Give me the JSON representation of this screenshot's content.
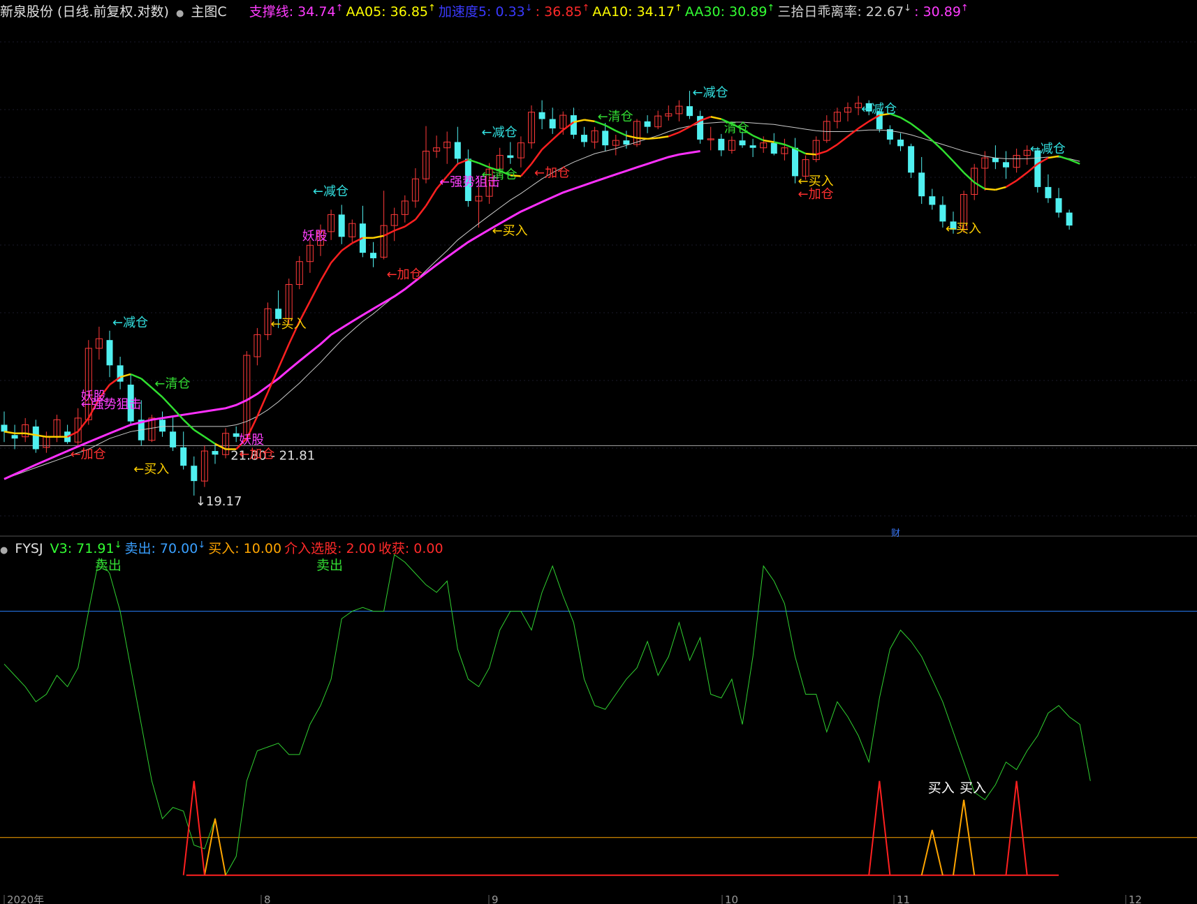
{
  "header": {
    "title": "新泉股份 (日线.前复权.对数)",
    "main_label": "主图C",
    "indicators": [
      {
        "label": "支撑线: 34.74",
        "arrow": "↑",
        "color": "#ff3cff"
      },
      {
        "label": "AA05: 36.85",
        "arrow": "↑",
        "color": "#ffff00"
      },
      {
        "label": "加速度5: 0.33",
        "arrow": "↓",
        "color": "#3a3aff"
      },
      {
        "label": ": 36.85",
        "arrow": "↑",
        "color": "#ff2a2a"
      },
      {
        "label": "AA10: 34.17",
        "arrow": "↑",
        "color": "#ffff00"
      },
      {
        "label": "AA30: 30.89",
        "arrow": "↑",
        "color": "#33ff33"
      },
      {
        "label": "三拾日乖离率: 22.67",
        "arrow": "↓",
        "color": "#d0d0d0"
      },
      {
        "label": ": 30.89",
        "arrow": "↑",
        "color": "#ff3cff"
      }
    ]
  },
  "sub_header": {
    "name": "FYSJ",
    "items": [
      {
        "label": "V3: 71.91",
        "arrow": "↓",
        "color": "#33ff33"
      },
      {
        "label": "卖出: 70.00",
        "arrow": "↓",
        "color": "#3aa0ff"
      },
      {
        "label": "买入: 10.00",
        "arrow": "",
        "color": "#ffa500"
      },
      {
        "label": "介入选股: 2.00",
        "arrow": "",
        "color": "#ff2a2a"
      },
      {
        "label": "收获: 0.00",
        "arrow": "",
        "color": "#ff2a2a"
      }
    ]
  },
  "price_labels": {
    "low": "19.17",
    "range": "21.80 - 21.81"
  },
  "signals": [
    {
      "text": "←减仓",
      "color": "#33e0e0",
      "i": 10,
      "p": 29.6
    },
    {
      "text": "←清仓",
      "color": "#33dd33",
      "i": 14,
      "p": 25.3
    },
    {
      "text": "←加仓",
      "color": "#ff3030",
      "i": 6,
      "p": 21.1
    },
    {
      "text": "←买入",
      "color": "#ffd000",
      "i": 12,
      "p": 20.3
    },
    {
      "text": "←强势狙击",
      "color": "#ff40ff",
      "i": 7,
      "p": 24.0
    },
    {
      "text": "妖股",
      "color": "#ff40ff",
      "i": 7,
      "p": 24.5
    },
    {
      "text": "妖股",
      "color": "#ff40ff",
      "i": 22,
      "p": 21.9
    },
    {
      "text": "←加仓",
      "color": "#ff3030",
      "i": 22,
      "p": 21.1
    },
    {
      "text": "←买入",
      "color": "#ffd000",
      "i": 25,
      "p": 29.5
    },
    {
      "text": "←减仓",
      "color": "#33e0e0",
      "i": 29,
      "p": 41.5
    },
    {
      "text": "妖股",
      "color": "#ff40ff",
      "i": 28,
      "p": 37.0
    },
    {
      "text": "←加仓",
      "color": "#ff3030",
      "i": 36,
      "p": 33.5
    },
    {
      "text": "←强势狙击",
      "color": "#ff40ff",
      "i": 41,
      "p": 42.5
    },
    {
      "text": "←减仓",
      "color": "#33e0e0",
      "i": 45,
      "p": 48.3
    },
    {
      "text": "←清仓",
      "color": "#33dd33",
      "i": 45,
      "p": 43.3
    },
    {
      "text": "←加仓",
      "color": "#ff3030",
      "i": 50,
      "p": 43.5
    },
    {
      "text": "←买入",
      "color": "#ffd000",
      "i": 46,
      "p": 37.5
    },
    {
      "text": "←清仓",
      "color": "#33dd33",
      "i": 56,
      "p": 50.3
    },
    {
      "text": "←减仓",
      "color": "#33e0e0",
      "i": 65,
      "p": 53.5
    },
    {
      "text": "清仓",
      "color": "#33dd33",
      "i": 68,
      "p": 48.8
    },
    {
      "text": "←买入",
      "color": "#ffd000",
      "i": 75,
      "p": 42.6
    },
    {
      "text": "←加仓",
      "color": "#ff3030",
      "i": 75,
      "p": 41.2
    },
    {
      "text": "←减仓",
      "color": "#33e0e0",
      "i": 81,
      "p": 51.3
    },
    {
      "text": "←买入",
      "color": "#ffd000",
      "i": 89,
      "p": 37.7
    },
    {
      "text": "←减仓",
      "color": "#33e0e0",
      "i": 97,
      "p": 46.3
    }
  ],
  "x_axis_labels": [
    "2020年",
    "8",
    "9",
    "10",
    "11",
    "12"
  ],
  "finance_marker": "财",
  "sub_annotations": [
    {
      "text": "卖出",
      "color": "#33dd33",
      "i": 9,
      "v": 81
    },
    {
      "text": "卖出",
      "color": "#33dd33",
      "i": 30,
      "v": 81
    },
    {
      "text": "买入",
      "color": "#ffffff",
      "i": 88,
      "v": 22
    },
    {
      "text": "买入",
      "color": "#ffffff",
      "i": 91,
      "v": 22
    }
  ],
  "chart_data": {
    "type": "candlestick",
    "scale": "log",
    "candles": [
      [
        23.0,
        23.8,
        22.0,
        22.6
      ],
      [
        22.4,
        23.0,
        21.6,
        22.2
      ],
      [
        22.3,
        23.4,
        22.0,
        23.0
      ],
      [
        22.9,
        23.3,
        21.4,
        21.6
      ],
      [
        21.7,
        22.6,
        21.4,
        22.3
      ],
      [
        22.3,
        23.6,
        22.0,
        23.3
      ],
      [
        22.6,
        23.0,
        21.9,
        22.0
      ],
      [
        22.0,
        24.0,
        21.8,
        23.4
      ],
      [
        23.3,
        28.6,
        23.0,
        28.0
      ],
      [
        28.0,
        29.6,
        27.2,
        28.7
      ],
      [
        28.6,
        29.3,
        26.0,
        26.8
      ],
      [
        26.8,
        27.4,
        25.2,
        25.7
      ],
      [
        25.5,
        26.2,
        23.0,
        23.2
      ],
      [
        23.3,
        24.5,
        21.8,
        22.1
      ],
      [
        22.1,
        23.6,
        22.0,
        23.4
      ],
      [
        23.3,
        23.8,
        22.3,
        22.6
      ],
      [
        22.6,
        23.5,
        21.5,
        21.7
      ],
      [
        21.7,
        22.6,
        20.5,
        20.7
      ],
      [
        20.7,
        21.2,
        19.17,
        19.9
      ],
      [
        19.9,
        21.8,
        19.6,
        21.5
      ],
      [
        21.5,
        21.9,
        20.8,
        21.3
      ],
      [
        21.3,
        22.8,
        21.1,
        22.5
      ],
      [
        22.5,
        22.9,
        22.0,
        22.3
      ],
      [
        22.2,
        27.8,
        22.0,
        27.5
      ],
      [
        27.4,
        29.5,
        26.8,
        29.0
      ],
      [
        29.0,
        31.5,
        28.6,
        31.0
      ],
      [
        31.0,
        32.5,
        29.5,
        30.2
      ],
      [
        30.2,
        33.5,
        29.8,
        33.0
      ],
      [
        33.0,
        35.5,
        32.6,
        35.0
      ],
      [
        35.0,
        37.0,
        34.0,
        36.5
      ],
      [
        36.5,
        38.5,
        35.5,
        37.8
      ],
      [
        37.8,
        40.0,
        37.0,
        39.5
      ],
      [
        39.5,
        40.5,
        36.6,
        37.3
      ],
      [
        37.3,
        39.0,
        36.8,
        38.6
      ],
      [
        38.6,
        40.4,
        35.4,
        35.8
      ],
      [
        35.8,
        36.8,
        34.5,
        35.3
      ],
      [
        35.4,
        42.0,
        35.2,
        38.4
      ],
      [
        38.4,
        40.2,
        36.9,
        39.5
      ],
      [
        39.5,
        41.5,
        38.7,
        40.9
      ],
      [
        40.9,
        44.5,
        40.2,
        43.3
      ],
      [
        43.3,
        49.6,
        42.8,
        46.5
      ],
      [
        46.5,
        48.4,
        45.7,
        46.9
      ],
      [
        46.9,
        48.9,
        45.0,
        47.6
      ],
      [
        47.6,
        49.5,
        44.9,
        45.6
      ],
      [
        45.6,
        46.7,
        40.3,
        40.9
      ],
      [
        40.9,
        42.4,
        38.2,
        41.4
      ],
      [
        41.4,
        45.1,
        40.6,
        44.4
      ],
      [
        44.4,
        46.9,
        43.7,
        46.0
      ],
      [
        46.0,
        47.6,
        45.0,
        45.7
      ],
      [
        45.7,
        48.3,
        44.6,
        47.5
      ],
      [
        47.5,
        52.3,
        46.8,
        51.4
      ],
      [
        51.4,
        53.0,
        49.2,
        50.5
      ],
      [
        50.5,
        52.0,
        48.6,
        49.3
      ],
      [
        49.3,
        51.5,
        48.5,
        51.0
      ],
      [
        51.0,
        52.0,
        48.0,
        48.5
      ],
      [
        48.5,
        49.5,
        47.0,
        47.6
      ],
      [
        47.6,
        49.5,
        46.8,
        49.0
      ],
      [
        49.0,
        50.0,
        46.5,
        47.2
      ],
      [
        47.2,
        48.5,
        46.0,
        47.8
      ],
      [
        47.8,
        49.0,
        46.8,
        47.3
      ],
      [
        47.3,
        50.5,
        47.0,
        50.2
      ],
      [
        50.2,
        51.0,
        48.7,
        49.5
      ],
      [
        49.5,
        51.6,
        49.2,
        50.9
      ],
      [
        50.9,
        52.3,
        50.3,
        51.2
      ],
      [
        51.2,
        53.0,
        50.2,
        52.2
      ],
      [
        52.2,
        54.3,
        50.5,
        50.9
      ],
      [
        50.9,
        51.6,
        47.4,
        47.9
      ],
      [
        47.9,
        49.5,
        46.6,
        48.0
      ],
      [
        48.0,
        48.6,
        45.9,
        46.6
      ],
      [
        46.6,
        48.3,
        46.2,
        47.8
      ],
      [
        47.8,
        48.9,
        46.9,
        47.2
      ],
      [
        47.2,
        48.0,
        45.8,
        46.9
      ],
      [
        46.9,
        48.3,
        46.3,
        47.5
      ],
      [
        47.5,
        48.7,
        46.0,
        46.2
      ],
      [
        46.2,
        48.0,
        45.4,
        46.9
      ],
      [
        46.9,
        48.1,
        42.8,
        43.6
      ],
      [
        43.6,
        46.0,
        43.2,
        45.5
      ],
      [
        45.5,
        48.3,
        45.2,
        47.8
      ],
      [
        47.8,
        51.0,
        47.5,
        50.2
      ],
      [
        50.2,
        52.0,
        49.3,
        51.4
      ],
      [
        51.4,
        52.7,
        50.2,
        52.0
      ],
      [
        52.0,
        53.6,
        51.0,
        52.6
      ],
      [
        52.6,
        53.0,
        51.0,
        51.5
      ],
      [
        51.5,
        51.9,
        48.8,
        49.2
      ],
      [
        49.2,
        49.7,
        47.3,
        47.9
      ],
      [
        47.9,
        48.7,
        46.5,
        47.1
      ],
      [
        47.1,
        47.4,
        43.4,
        44.0
      ],
      [
        44.0,
        45.8,
        40.6,
        41.4
      ],
      [
        41.4,
        42.2,
        40.0,
        40.5
      ],
      [
        40.5,
        41.4,
        38.2,
        38.8
      ],
      [
        38.8,
        39.8,
        37.6,
        38.0
      ],
      [
        38.0,
        42.0,
        37.7,
        41.6
      ],
      [
        41.6,
        45.0,
        41.0,
        44.5
      ],
      [
        44.5,
        46.5,
        42.0,
        45.7
      ],
      [
        45.7,
        47.2,
        44.4,
        45.2
      ],
      [
        45.2,
        46.5,
        43.3,
        44.6
      ],
      [
        44.6,
        46.8,
        44.0,
        46.0
      ],
      [
        46.0,
        47.2,
        44.9,
        46.6
      ],
      [
        46.6,
        47.0,
        41.8,
        42.4
      ],
      [
        42.4,
        43.8,
        40.7,
        41.2
      ],
      [
        41.2,
        42.3,
        39.2,
        39.7
      ],
      [
        39.7,
        40.0,
        38.0,
        38.4
      ]
    ],
    "ma_fast": [
      22.6,
      22.5,
      22.5,
      22.4,
      22.3,
      22.3,
      22.3,
      22.6,
      23.4,
      24.6,
      25.5,
      26.0,
      26.2,
      25.9,
      25.3,
      24.7,
      24.0,
      23.3,
      22.7,
      22.3,
      21.9,
      21.6,
      21.6,
      22.2,
      23.5,
      25.0,
      26.6,
      28.3,
      30.0,
      31.6,
      33.3,
      34.9,
      36.0,
      36.7,
      37.2,
      37.2,
      37.4,
      37.9,
      38.3,
      39.0,
      40.4,
      42.2,
      43.6,
      45.0,
      45.5,
      45.1,
      44.6,
      44.2,
      43.7,
      43.6,
      45.0,
      46.7,
      47.9,
      49.1,
      50.1,
      50.4,
      50.2,
      49.7,
      49.0,
      48.4,
      48.1,
      48.0,
      48.1,
      48.3,
      48.8,
      49.5,
      50.3,
      50.8,
      50.5,
      49.9,
      49.2,
      48.4,
      47.8,
      47.6,
      47.3,
      46.8,
      46.2,
      46.1,
      46.5,
      47.3,
      48.3,
      49.3,
      50.2,
      51.0,
      51.2,
      50.7,
      49.9,
      48.9,
      47.8,
      46.6,
      45.3,
      44.0,
      42.9,
      42.2,
      42.1,
      42.4,
      43.1,
      44.0,
      45.0,
      45.7,
      45.9,
      45.5,
      45.0
    ],
    "ma_slow": [
      20.0,
      20.2,
      20.4,
      20.6,
      20.8,
      21.0,
      21.2,
      21.4,
      21.6,
      21.9,
      22.2,
      22.4,
      22.6,
      22.7,
      22.8,
      22.9,
      22.9,
      22.9,
      22.9,
      22.9,
      22.9,
      22.9,
      23.0,
      23.2,
      23.5,
      23.9,
      24.4,
      25.0,
      25.6,
      26.3,
      27.0,
      27.8,
      28.6,
      29.3,
      30.0,
      30.6,
      31.3,
      32.0,
      32.6,
      33.3,
      34.2,
      35.1,
      36.0,
      37.0,
      37.8,
      38.6,
      39.4,
      40.2,
      41.0,
      41.7,
      42.5,
      43.3,
      44.0,
      44.6,
      45.2,
      45.7,
      46.2,
      46.5,
      46.8,
      47.2,
      47.6,
      48.0,
      48.4,
      48.9,
      49.3,
      49.6,
      49.9,
      50.0,
      50.1,
      50.1,
      50.1,
      50.0,
      49.9,
      49.8,
      49.6,
      49.4,
      49.2,
      49.0,
      48.9,
      48.9,
      48.9,
      49.0,
      49.1,
      49.1,
      49.0,
      48.8,
      48.5,
      48.1,
      47.7,
      47.3,
      46.9,
      46.5,
      46.2,
      45.9,
      45.7,
      45.6,
      45.6,
      45.6,
      45.7,
      45.8,
      45.8,
      45.6,
      45.3
    ],
    "support_line": [
      20.0,
      20.25,
      20.5,
      20.75,
      21.0,
      21.25,
      21.5,
      21.75,
      22.0,
      22.25,
      22.5,
      22.75,
      23.0,
      23.15,
      23.3,
      23.4,
      23.5,
      23.6,
      23.7,
      23.8,
      23.9,
      24.0,
      24.2,
      24.5,
      24.9,
      25.4,
      25.9,
      26.5,
      27.1,
      27.7,
      28.3,
      29.0,
      29.5,
      30.0,
      30.5,
      31.0,
      31.5,
      32.0,
      32.6,
      33.3,
      34.0,
      34.7,
      35.4,
      36.1,
      36.8,
      37.4,
      38.0,
      38.6,
      39.2,
      39.8,
      40.3,
      40.8,
      41.3,
      41.8,
      42.2,
      42.6,
      43.0,
      43.4,
      43.8,
      44.2,
      44.6,
      45.0,
      45.4,
      45.8,
      46.1,
      46.3,
      46.5
    ]
  },
  "sub_chart_data": {
    "type": "line",
    "ylim": [
      -3,
      84
    ],
    "sell_level": 70,
    "buy_level": 10,
    "v3": [
      56,
      53,
      50,
      46,
      48,
      53,
      50,
      55,
      70,
      84,
      80,
      70,
      55,
      40,
      25,
      15,
      18,
      17,
      8,
      7,
      15,
      0,
      5,
      25,
      33,
      34,
      35,
      32,
      32,
      40,
      45,
      52,
      68,
      70,
      71,
      70,
      70,
      85,
      83,
      80,
      77,
      75,
      78,
      60,
      52,
      50,
      55,
      65,
      70,
      70,
      65,
      75,
      82,
      74,
      67,
      52,
      45,
      44,
      48,
      52,
      55,
      62,
      53,
      58,
      67,
      57,
      63,
      48,
      47,
      52,
      40,
      58,
      82,
      78,
      72,
      58,
      48,
      48,
      38,
      46,
      42,
      37,
      30,
      47,
      60,
      65,
      62,
      58,
      52,
      46,
      38,
      30,
      22,
      20,
      24,
      30,
      28,
      33,
      37,
      43,
      45,
      42,
      40,
      25
    ],
    "buy_signal": [
      0,
      0,
      0,
      0,
      0,
      0,
      0,
      0,
      0,
      0,
      0,
      0,
      0,
      0,
      0,
      0,
      0,
      0,
      0,
      0,
      15,
      0,
      0,
      0,
      0,
      0,
      0,
      0,
      0,
      0,
      0,
      0,
      0,
      0,
      0,
      0,
      0,
      0,
      0,
      0,
      0,
      0,
      0,
      0,
      0,
      0,
      0,
      0,
      0,
      0,
      0,
      0,
      0,
      0,
      0,
      0,
      0,
      0,
      0,
      0,
      0,
      0,
      0,
      0,
      0,
      0,
      0,
      0,
      0,
      0,
      0,
      0,
      0,
      0,
      0,
      0,
      0,
      0,
      0,
      0,
      0,
      0,
      0,
      0,
      0,
      0,
      0,
      0,
      12,
      0,
      0,
      20,
      0,
      0,
      0,
      0,
      0,
      0,
      0,
      0,
      0,
      0,
      0,
      0
    ],
    "enter_signal": [
      0,
      0,
      0,
      0,
      0,
      0,
      0,
      0,
      0,
      0,
      0,
      0,
      0,
      0,
      0,
      0,
      0,
      0,
      25,
      0,
      0,
      0,
      0,
      0,
      0,
      0,
      0,
      0,
      0,
      0,
      0,
      0,
      0,
      0,
      0,
      0,
      0,
      0,
      0,
      0,
      0,
      0,
      0,
      0,
      0,
      0,
      0,
      0,
      0,
      0,
      0,
      0,
      0,
      0,
      0,
      0,
      0,
      0,
      0,
      0,
      0,
      0,
      0,
      0,
      0,
      0,
      0,
      0,
      0,
      0,
      0,
      0,
      0,
      0,
      0,
      0,
      0,
      0,
      0,
      0,
      0,
      0,
      0,
      25,
      0,
      0,
      0,
      0,
      0,
      0,
      0,
      0,
      0,
      0,
      0,
      0,
      25,
      0,
      0,
      0,
      0,
      0,
      0
    ]
  }
}
